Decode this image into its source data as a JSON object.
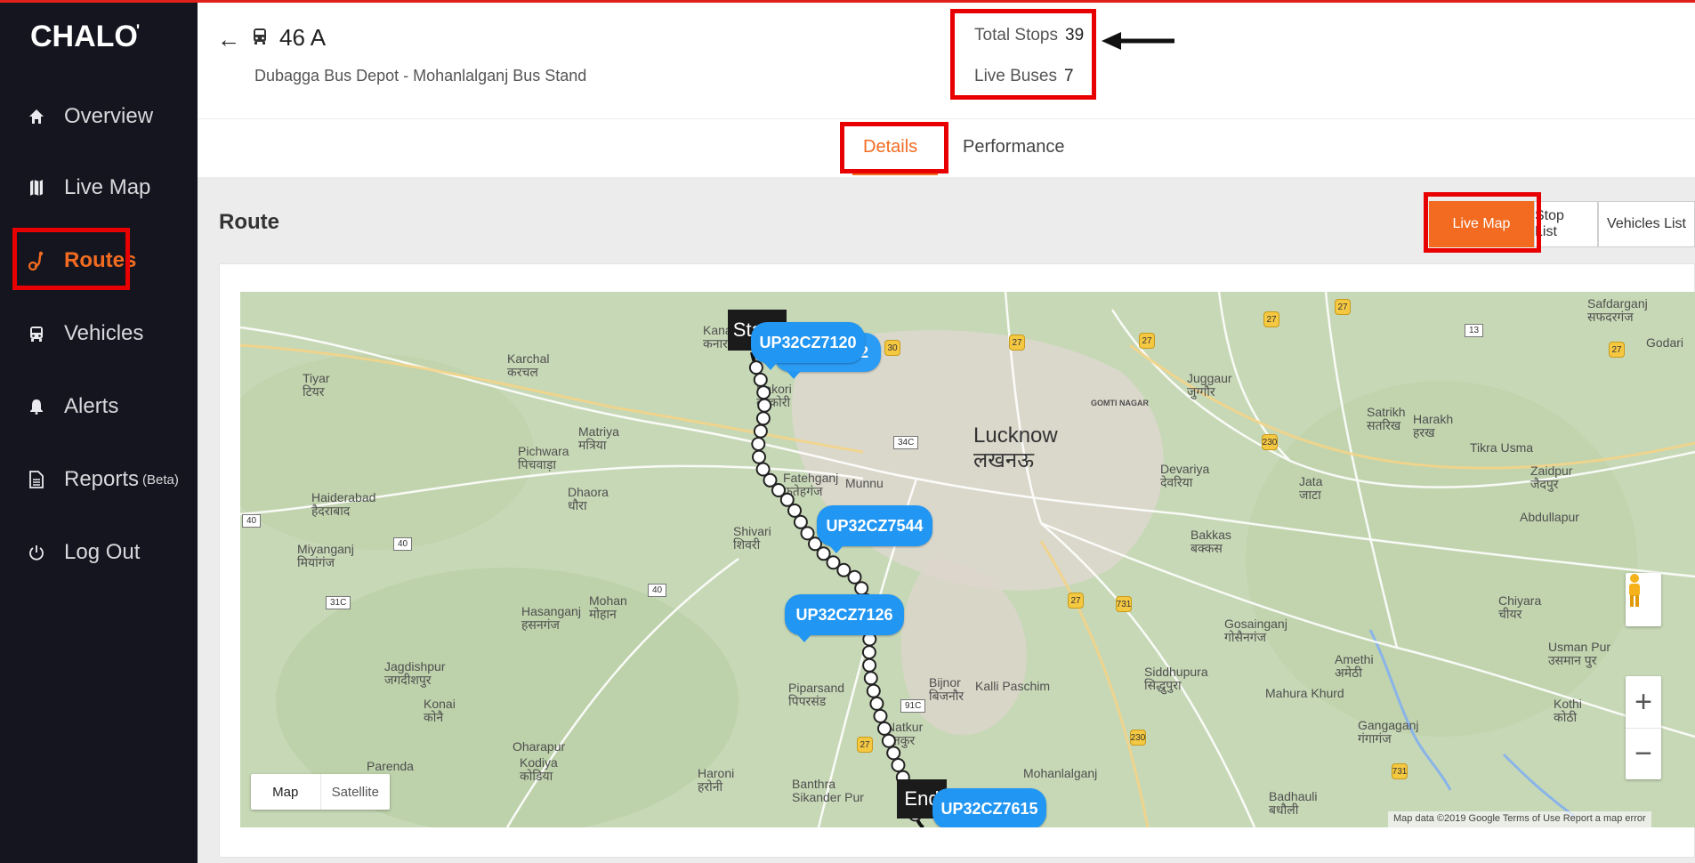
{
  "brand": {
    "logo": "CHALO",
    "accent": "#f26b21",
    "sidebar_bg": "#15151f",
    "annotation": "#e80000",
    "bus_tag": "#2196f3"
  },
  "sidebar": {
    "items": [
      {
        "label": "Overview",
        "icon": "home-icon"
      },
      {
        "label": "Live Map",
        "icon": "map-icon"
      },
      {
        "label": "Routes",
        "icon": "route-icon",
        "active": true
      },
      {
        "label": "Vehicles",
        "icon": "bus-icon"
      },
      {
        "label": "Alerts",
        "icon": "bell-icon"
      },
      {
        "label": "Reports",
        "badge": "(Beta)",
        "icon": "document-icon"
      },
      {
        "label": "Log Out",
        "icon": "power-icon"
      }
    ]
  },
  "header": {
    "route_number": "46 A",
    "route_description": "Dubagga Bus Depot - Mohanlalganj Bus Stand",
    "total_stops_label": "Total Stops",
    "total_stops_value": "39",
    "live_buses_label": "Live Buses",
    "live_buses_value": "7"
  },
  "tabs": {
    "details": "Details",
    "performance": "Performance",
    "active": "details"
  },
  "section": {
    "title": "Route"
  },
  "view_toggle": {
    "live_map": "Live Map",
    "stop_list": "Stop List",
    "vehicles_list": "Vehicles List",
    "active": "live_map"
  },
  "map": {
    "start_label": "Start",
    "end_label": "End",
    "buses": [
      "UP32CZ7120",
      "UP32CZ7544",
      "UP32CZ7126",
      "UP32CZ7615"
    ],
    "hidden_bus_fragment": "62",
    "map_type": {
      "map": "Map",
      "satellite": "Satellite"
    },
    "zoom_in": "+",
    "zoom_out": "−",
    "attribution": "Map data ©2019 Google   Terms of Use   Report a map error",
    "places": {
      "lucknow": "Lucknow",
      "lucknow_hi": "लखनऊ",
      "karchal": "Karchal",
      "karchal_hi": "करचल",
      "kanar": "Kanar",
      "kanar_hi": "कनार",
      "tiyar": "Tiyar",
      "tiyar_hi": "टियर",
      "kakori": "Kakori",
      "kakori_hi": "काकोरी",
      "matriya": "Matriya",
      "matriya_hi": "मत्रिया",
      "pichwara": "Pichwara",
      "pichwara_hi": "पिचवाड़ा",
      "haiderabad": "Haiderabad",
      "haiderabad_hi": "हैदराबाद",
      "dhaora": "Dhaora",
      "dhaora_hi": "धौरा",
      "fatehganj": "Fatehganj",
      "fatehganj_hi": "फतेहगंज",
      "munnu": "Munnu",
      "shivari": "Shivari",
      "shivari_hi": "शिवरी",
      "miyanganj": "Miyanganj",
      "miyanganj_hi": "मियांगंज",
      "hasanganj": "Hasanganj",
      "hasanganj_hi": "हसनगंज",
      "mohan": "Mohan",
      "mohan_hi": "मोहान",
      "jagdishpur": "Jagdishpur",
      "jagdishpur_hi": "जगदीशपुर",
      "konai": "Konai",
      "konai_hi": "कोनै",
      "parenda": "Parenda",
      "oharapur": "Oharapur",
      "kodiya": "Kodiya",
      "kodiya_hi": "कोडिया",
      "haroni": "Haroni",
      "haroni_hi": "हरोनी",
      "banthra": "Banthra",
      "sikander_pur": "Sikander Pur",
      "piparsand": "Piparsand",
      "piparsand_hi": "पिपरसंड",
      "bijnor": "Bijnor",
      "bijnor_hi": "बिजनौर",
      "kalli_paschim": "Kalli Paschim",
      "natkur": "Natkur",
      "natkur_hi": "नतकुर",
      "gomti_nagar": "GOMTI NAGAR",
      "juggaur": "Juggaur",
      "juggaur_hi": "जुग्गौर",
      "devariya": "Devariya",
      "devariya_hi": "देवरिया",
      "jata": "Jata",
      "jata_hi": "जाटा",
      "bakkas": "Bakkas",
      "bakkas_hi": "बक्कस",
      "gosainganj": "Gosainganj",
      "gosainganj_hi": "गोसैनगंज",
      "siddhupura": "Siddhupura",
      "siddhupura_hi": "सिद्धुपुरा",
      "amethi": "Amethi",
      "amethi_hi": "अमेठी",
      "mahura_khurd": "Mahura Khurd",
      "gangaganj": "Gangaganj",
      "gangaganj_hi": "गंगागंज",
      "badhauli": "Badhauli",
      "badhauli_hi": "बधौली",
      "satrikh": "Satrikh",
      "satrikh_hi": "सतरिख",
      "harakh": "Harakh",
      "harakh_hi": "हरख",
      "tikra_usma": "Tikra Usma",
      "zaidpur": "Zaidpur",
      "zaidpur_hi": "जैदपुर",
      "abdullapur": "Abdullapur",
      "chiyara": "Chiyara",
      "chiyara_hi": "चीयर",
      "usman_pur": "Usman Pur",
      "usman_pur_hi": "उसमान पुर",
      "kothi": "Kothi",
      "kothi_hi": "कोठी",
      "safdarganj": "Safdarganj",
      "safdarganj_hi": "सफदरगंज",
      "godari": "Godari",
      "mohanlalganj": "Mohanlalganj"
    }
  }
}
